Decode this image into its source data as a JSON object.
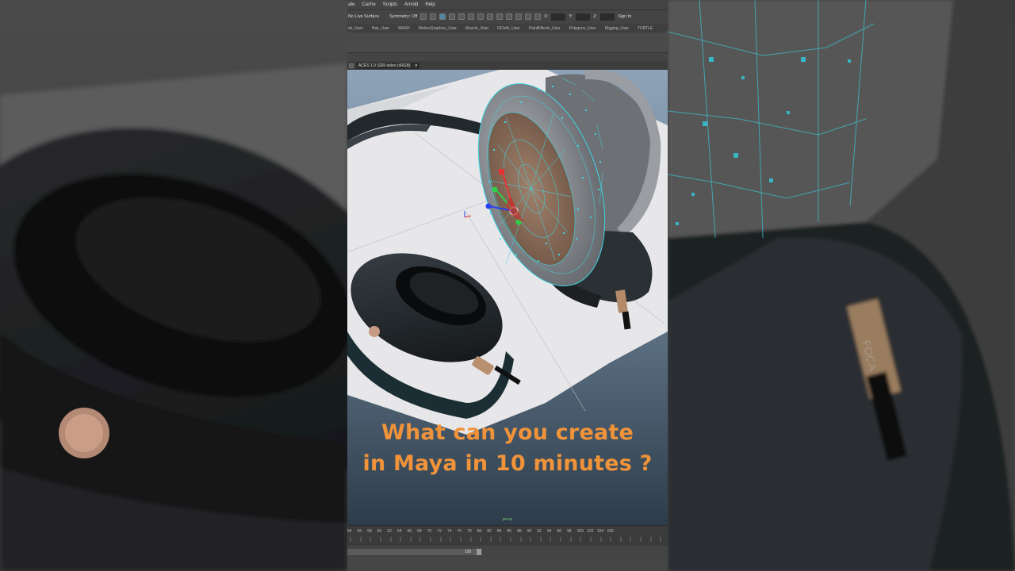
{
  "menubar": {
    "items": [
      "ate",
      "Cache",
      "Scripts",
      "Arnold",
      "Help"
    ]
  },
  "statusline": {
    "live_surface": "No Live Surface",
    "symmetry": "Symmetry: Off",
    "x_label": "X:",
    "y_label": "Y:",
    "z_label": "Z:",
    "sign_in": "Sign In"
  },
  "shelf_tabs": [
    "ds_User",
    "Hair_User",
    "MASH",
    "MotionGraphics_User",
    "Muscle_User",
    "NCloth_User",
    "PaintEffects_User",
    "Polygons_User",
    "Rigging_User",
    "TURTLE"
  ],
  "viewport": {
    "color_space": "ACES 1.0 SDR-video (sRGB)",
    "camera_label": "persp"
  },
  "overlay": {
    "line1": "What can you create",
    "line2": "in Maya in 10 minutes ?",
    "color": "#f0933a"
  },
  "timeline": {
    "ticks": [
      "54",
      "56",
      "58",
      "60",
      "62",
      "64",
      "66",
      "68",
      "70",
      "72",
      "74",
      "76",
      "78",
      "80",
      "82",
      "84",
      "86",
      "88",
      "90",
      "92",
      "94",
      "96",
      "98",
      "100",
      "102",
      "104",
      "106"
    ],
    "range_end": "150"
  },
  "colors": {
    "ui_panel": "#444444",
    "accent_blue": "#5285a6",
    "viewport_floor": "#e7e7ea",
    "wire": "#3fd7e6"
  }
}
